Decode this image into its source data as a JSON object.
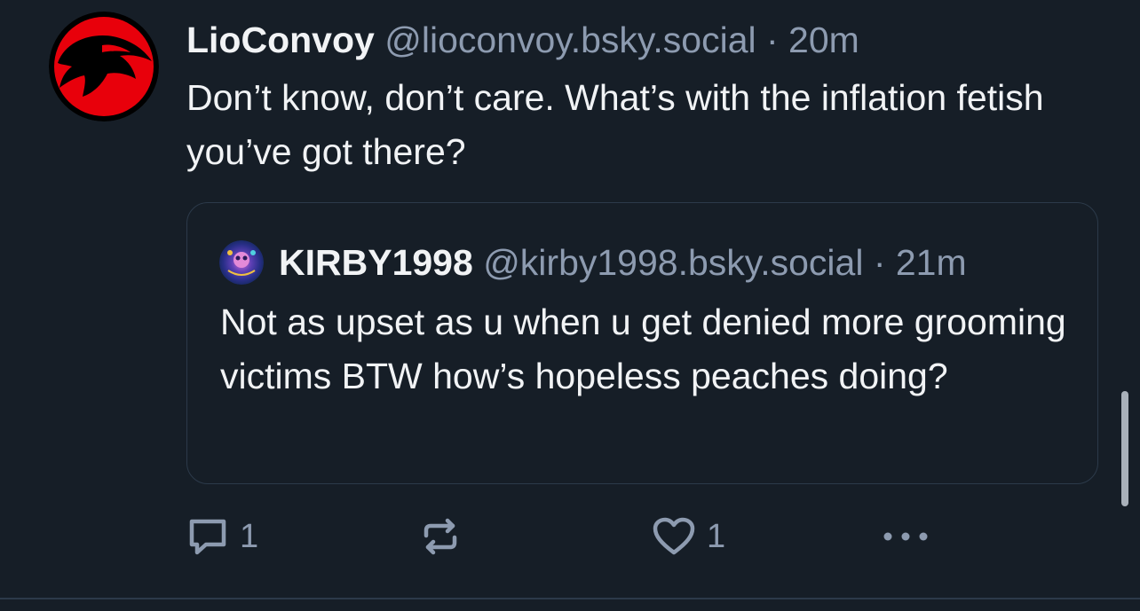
{
  "post": {
    "author": {
      "name": "LioConvoy",
      "handle_and_time": "@lioconvoy.bsky.social · 20m",
      "avatar_icon": "thundercats-logo"
    },
    "text": "Don’t know, don’t care. What’s with the inflation fetish you’ve got there?",
    "quote": {
      "author": {
        "name": "KIRBY1998",
        "handle_and_time": "@kirby1998.bsky.social · 21m",
        "avatar_icon": "psychedelic-art-avatar"
      },
      "text": "Not as upset as u when u get denied more grooming victims BTW how’s hopeless peaches doing?"
    },
    "actions": {
      "reply": {
        "icon": "reply-icon",
        "count": "1"
      },
      "repost": {
        "icon": "repost-icon",
        "count": ""
      },
      "like": {
        "icon": "heart-icon",
        "count": "1"
      },
      "more": {
        "icon": "more-options-icon"
      }
    }
  },
  "colors": {
    "background": "#161e27",
    "text": "#f1f3f5",
    "muted": "#8d9bb0",
    "border": "#2c3a4a",
    "avatar_red": "#e8000b"
  }
}
